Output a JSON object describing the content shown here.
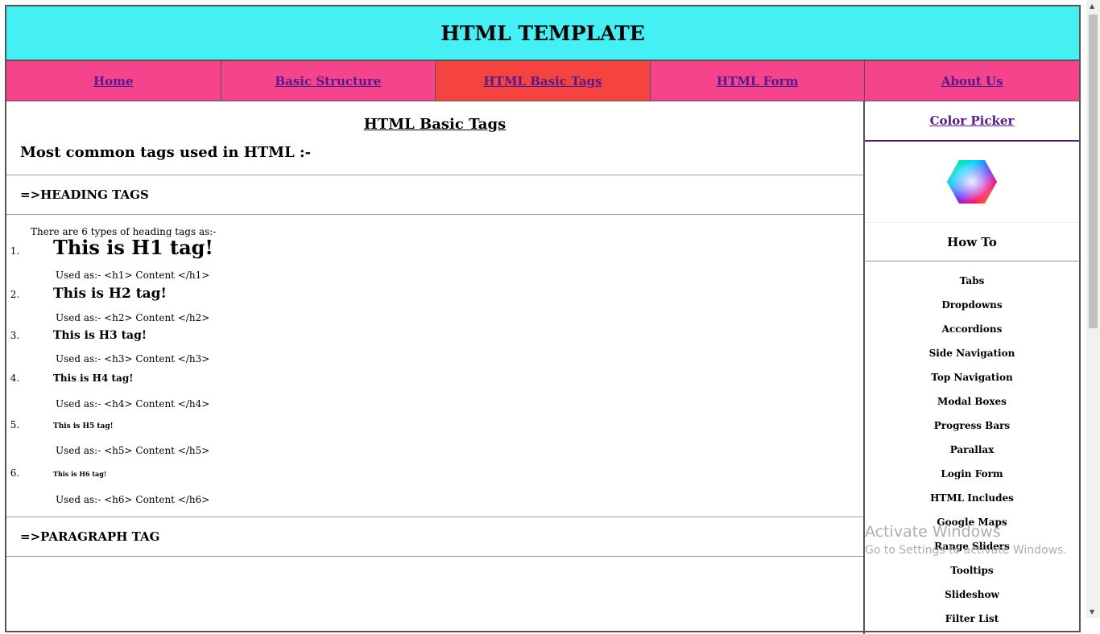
{
  "header": {
    "title": "HTML TEMPLATE"
  },
  "nav": [
    "Home",
    "Basic Structure",
    "HTML Basic Tags",
    "HTML Form",
    "About Us"
  ],
  "main": {
    "title": "HTML Basic Tags",
    "subtitle": "Most common tags used in HTML :-",
    "section_heading": "=>HEADING TAGS",
    "intro": "There are 6 types of heading tags as:-",
    "headings": [
      {
        "text": "This is H1 tag!",
        "usage": "Used as:- <h1> Content </h1>"
      },
      {
        "text": "This is H2 tag!",
        "usage": "Used as:- <h2> Content </h2>"
      },
      {
        "text": "This is H3 tag!",
        "usage": "Used as:- <h3> Content </h3>"
      },
      {
        "text": "This is H4 tag!",
        "usage": "Used as:- <h4> Content </h4>"
      },
      {
        "text": "This is H5 tag!",
        "usage": "Used as:- <h5> Content </h5>"
      },
      {
        "text": "This is H6 tag!",
        "usage": "Used as:- <h6> Content </h6>"
      }
    ],
    "section_paragraph": "=>PARAGRAPH TAG"
  },
  "sidebar": {
    "color_picker": "Color Picker",
    "how_to": "How To",
    "links": [
      "Tabs",
      "Dropdowns",
      "Accordions",
      "Side Navigation",
      "Top Navigation",
      "Modal Boxes",
      "Progress Bars",
      "Parallax",
      "Login Form",
      "HTML Includes",
      "Google Maps",
      "Range Sliders",
      "Tooltips",
      "Slideshow",
      "Filter List"
    ]
  },
  "watermark": {
    "line1": "Activate Windows",
    "line2": "Go to Settings to activate Windows."
  }
}
